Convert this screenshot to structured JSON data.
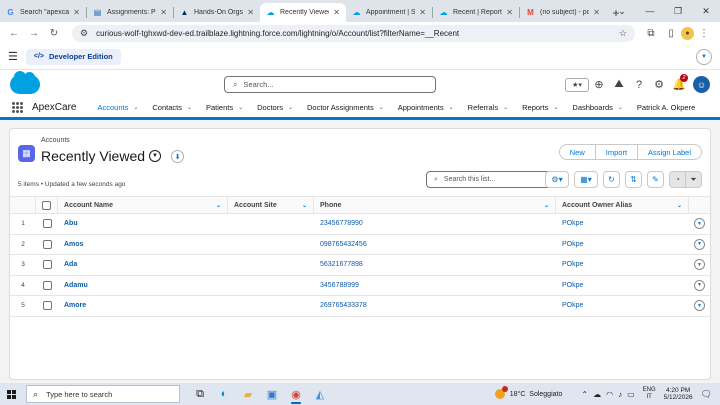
{
  "browser": {
    "tabs": [
      {
        "label": "Search \"apexcare",
        "icon": "S",
        "active": false
      },
      {
        "label": "Assignments: Pre",
        "icon": "A",
        "active": false
      },
      {
        "label": "Hands-On Orgs",
        "icon": "H",
        "active": false
      },
      {
        "label": "Recently Viewed",
        "icon": "R",
        "active": true
      },
      {
        "label": "Appointment | Sa",
        "icon": "A",
        "active": false
      },
      {
        "label": "Recent | Reports",
        "icon": "R",
        "active": false
      },
      {
        "label": "(no subject) - pcs",
        "icon": "M",
        "active": false
      }
    ],
    "new_tab": "+",
    "window_controls": [
      "⌄",
      "—",
      "❐",
      "✕"
    ],
    "url": "curious-wolf-tghxwd-dev-ed.trailblaze.lightning.force.com/lightning/o/Account/list?filterName=__Recent"
  },
  "devbar": {
    "label": "Developer Edition",
    "code_glyph": "</>"
  },
  "global": {
    "search_placeholder": "Search...",
    "notification_count": "2"
  },
  "appnav": {
    "app_name": "ApexCare",
    "items": [
      {
        "label": "Accounts",
        "active": true
      },
      {
        "label": "Contacts",
        "active": false
      },
      {
        "label": "Patients",
        "active": false
      },
      {
        "label": "Doctors",
        "active": false
      },
      {
        "label": "Doctor Assignments",
        "active": false
      },
      {
        "label": "Appointments",
        "active": false
      },
      {
        "label": "Referrals",
        "active": false
      },
      {
        "label": "Reports",
        "active": false
      },
      {
        "label": "Dashboards",
        "active": false
      },
      {
        "label": "Patrick A. Okpere",
        "active": false
      }
    ]
  },
  "list": {
    "breadcrumb": "Accounts",
    "title": "Recently Viewed",
    "meta": "5 items • Updated a few seconds ago",
    "actions": [
      "New",
      "Import",
      "Assign Label"
    ],
    "search_placeholder": "Search this list...",
    "columns": [
      "Account Name",
      "Account Site",
      "Phone",
      "Account Owner Alias"
    ],
    "rows": [
      {
        "num": "1",
        "name": "Abu",
        "site": "",
        "phone": "23456778990",
        "owner": "POkpe"
      },
      {
        "num": "2",
        "name": "Amos",
        "site": "",
        "phone": "098765432456",
        "owner": "POkpe"
      },
      {
        "num": "3",
        "name": "Ada",
        "site": "",
        "phone": "56321677898",
        "owner": "POkpe"
      },
      {
        "num": "4",
        "name": "Adamu",
        "site": "",
        "phone": "3456788999",
        "owner": "POkpe"
      },
      {
        "num": "5",
        "name": "Amore",
        "site": "",
        "phone": "269765433378",
        "owner": "POkpe"
      }
    ]
  },
  "taskbar": {
    "search_placeholder": "Type here to search",
    "temperature": "18°C",
    "weather": "Soleggiato",
    "lang_top": "ENG",
    "lang_bottom": "IT",
    "time": "4:20 PM",
    "date": "5/12/2026"
  },
  "colors": {
    "brand": "#0176d3",
    "link": "#0b5cab",
    "object_icon": "#5867e8",
    "cloud": "#00a1e0"
  }
}
